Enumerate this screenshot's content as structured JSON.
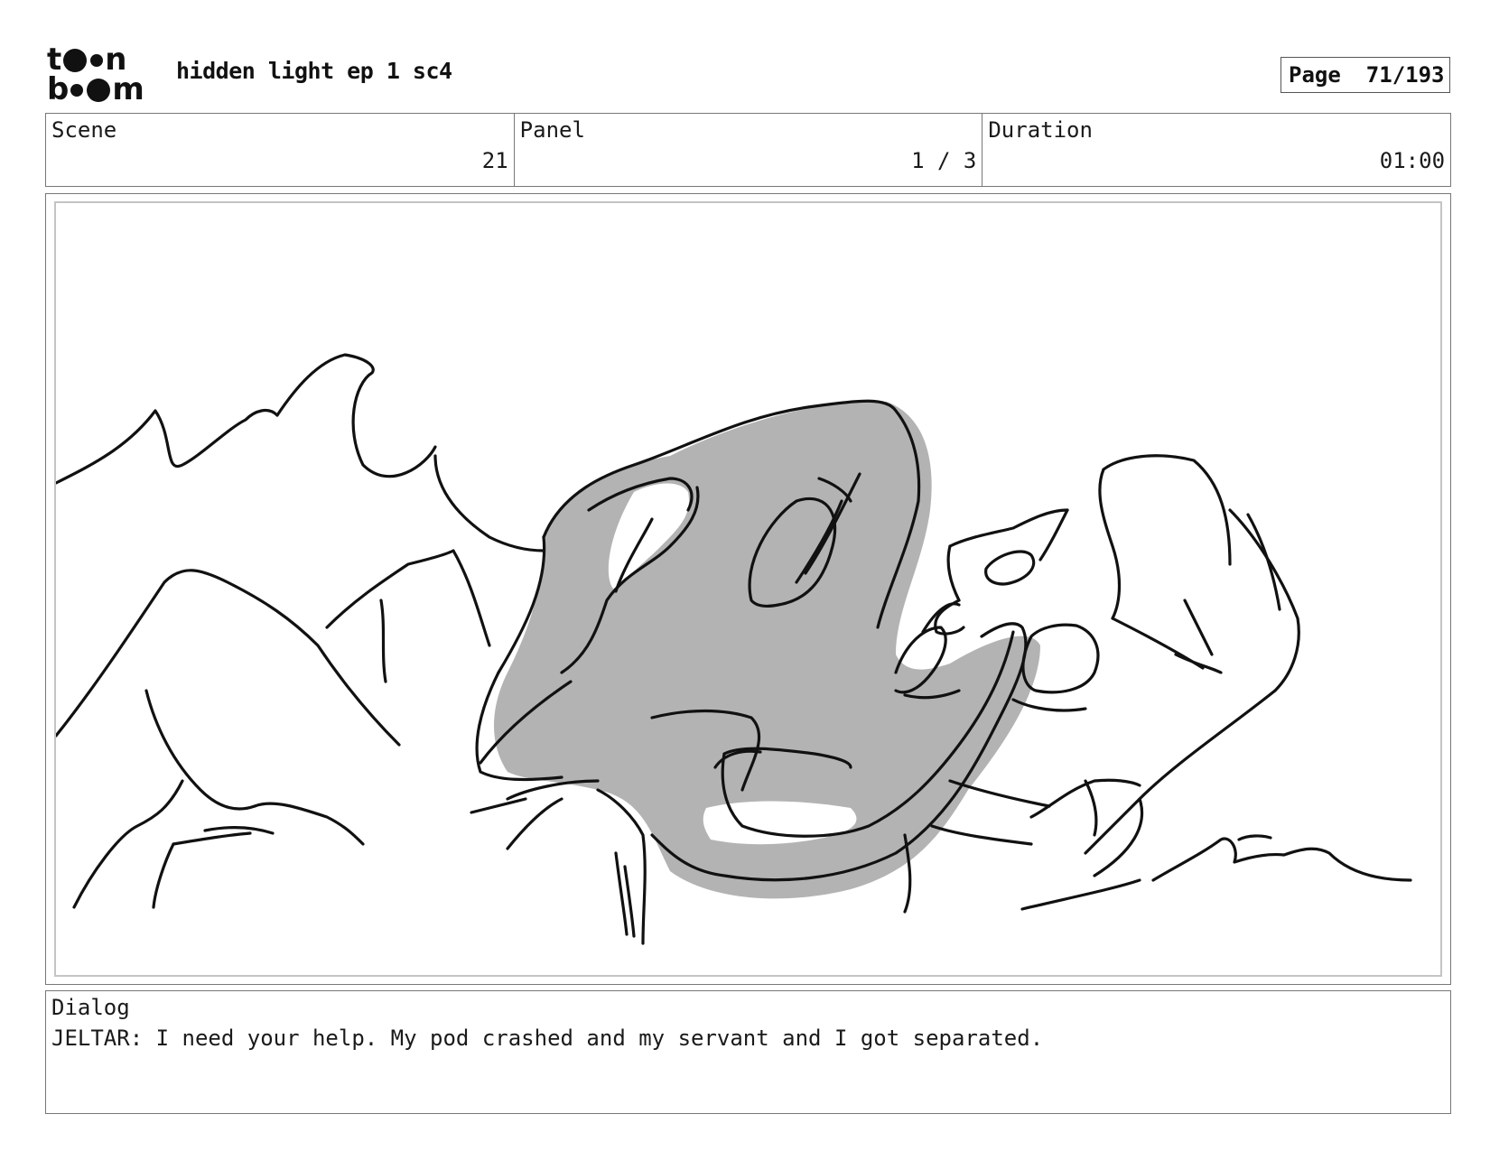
{
  "header": {
    "logo_line1": "t",
    "logo_line1_end": "n",
    "logo_line2": "b",
    "logo_line2_end": "m",
    "title": "hidden light ep 1 sc4",
    "page_label": "Page",
    "page_number": "71/193"
  },
  "info": {
    "scene_label": "Scene",
    "scene_value": "21",
    "panel_label": "Panel",
    "panel_value": "1 / 3",
    "duration_label": "Duration",
    "duration_value": "01:00"
  },
  "dialog": {
    "label": "Dialog",
    "text": "JELTAR: I need your help. My pod crashed and my servant and I got separated."
  },
  "colors": {
    "sketch_line": "#111111",
    "sketch_fill": "#b3b3b3"
  }
}
